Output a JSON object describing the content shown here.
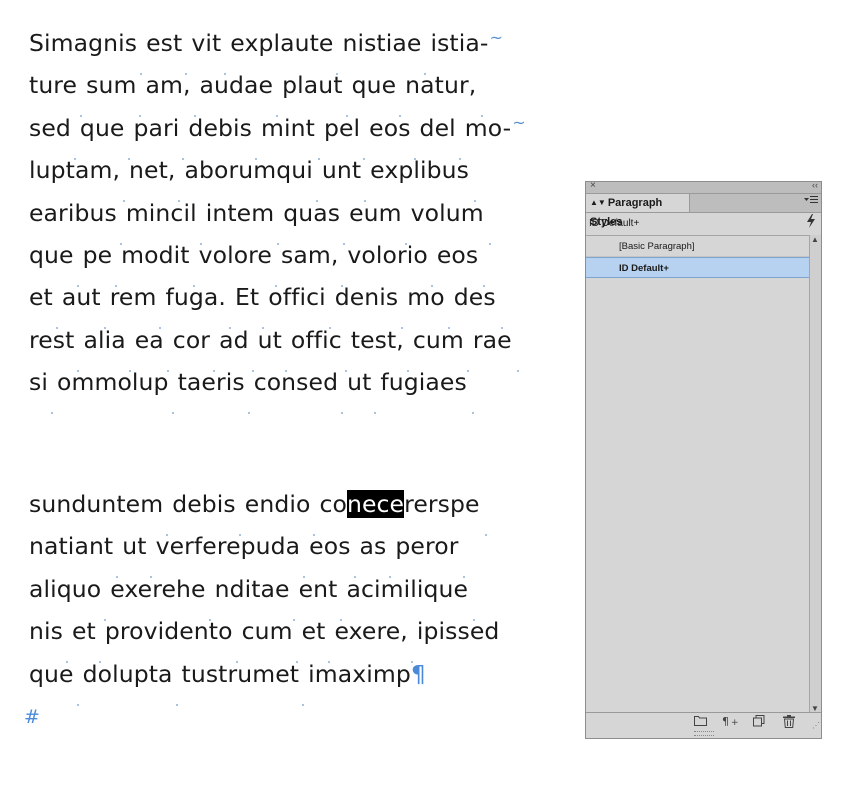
{
  "document": {
    "paragraph1": [
      {
        "words": [
          "Simagnis",
          "est",
          "vit",
          "explaute",
          "nistiae",
          "istia-"
        ],
        "hyphen_mark": "~"
      },
      {
        "words": [
          "ture",
          "sum",
          "am,",
          "audae",
          "plaut",
          "que",
          "natur,"
        ],
        "end_dot": true
      },
      {
        "words": [
          "sed",
          "que",
          "pari",
          "debis",
          "mint",
          "pel",
          "eos",
          "del",
          "mo-"
        ],
        "hyphen_mark": "~"
      },
      {
        "words": [
          "luptam,",
          "net,",
          "aborumqui",
          "unt",
          "explibus"
        ],
        "end_dot": true
      },
      {
        "words": [
          "earibus",
          "mincil",
          "intem",
          "quas",
          "eum",
          "volum"
        ],
        "end_dot": true
      },
      {
        "words": [
          "que",
          "pe",
          "modit",
          "volore",
          "sam,",
          "volorio",
          "eos"
        ],
        "end_dot": true
      },
      {
        "words": [
          "et",
          "aut",
          "rem",
          "fuga.",
          "Et",
          "offici",
          "denis",
          "mo",
          "des"
        ],
        "end_dot": true
      },
      {
        "words": [
          "rest",
          "alia",
          "ea",
          "cor",
          "ad",
          "ut",
          "offic",
          "test,",
          "cum",
          "rae"
        ],
        "end_dot": true
      },
      {
        "words": [
          "si",
          "ommolup",
          "taeris",
          "consed",
          "ut",
          "fugiaes"
        ],
        "end_dot": true
      }
    ],
    "paragraph2": [
      {
        "words": [
          "sunduntem",
          "debis",
          "endio",
          "co|nece|rerspe"
        ],
        "end_dot": true
      },
      {
        "words": [
          "natiant",
          "ut",
          "verferepuda",
          "eos",
          "as",
          "peror"
        ],
        "end_dot": true
      },
      {
        "words": [
          "aliquo",
          "exerehe",
          "nditae",
          "ent",
          "acimilique"
        ],
        "end_dot": true
      },
      {
        "words": [
          "nis",
          "et",
          "providento",
          "cum",
          "et",
          "exere,",
          "ipissed"
        ],
        "end_dot": false
      },
      {
        "words": [
          "que",
          "dolupta",
          "tustrumet",
          "imaximp"
        ],
        "pilcrow": "¶"
      }
    ],
    "selected_text": "nece",
    "end_of_story_marker": "#"
  },
  "panel": {
    "close_icon": "×",
    "collapse_icon": "‹‹",
    "tab_label": "Paragraph Styles",
    "tab_arrows_icon": "updown-arrows-icon",
    "menu_icon": "panel-menu-icon",
    "current_style": "ID Default+",
    "redefine_icon": "lightning-icon",
    "styles": [
      {
        "label": "[Basic Paragraph]",
        "selected": false
      },
      {
        "label": "ID Default+",
        "selected": true
      }
    ],
    "footer_icons": [
      "folder-icon",
      "clear-overrides-icon",
      "new-style-icon",
      "trash-icon"
    ]
  },
  "colors": {
    "selection_bg": "#b7d1f0",
    "hidden_char_blue": "#4a8ad8",
    "panel_bg": "#d6d6d6"
  }
}
